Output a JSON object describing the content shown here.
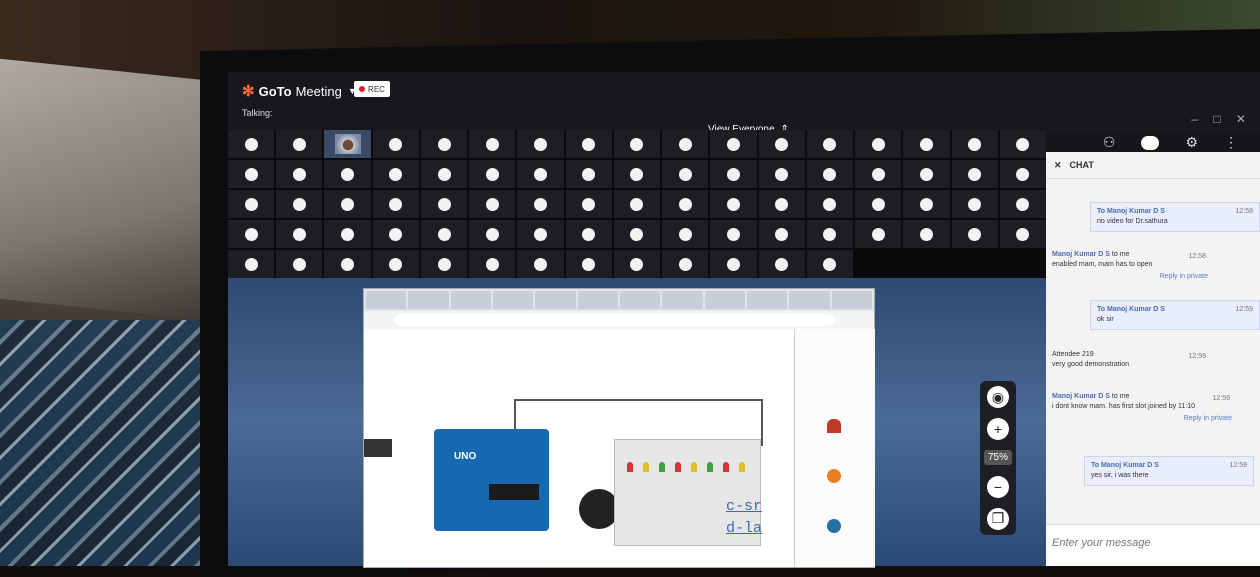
{
  "app": {
    "brand_goto": "GoTo",
    "brand_meeting": "Meeting",
    "rec_label": "REC",
    "talking_label": "Talking:"
  },
  "view": {
    "label": "View Everyone"
  },
  "chat": {
    "title": "CHAT",
    "messages": [
      {
        "dir": "out",
        "to": "To Manoj Kumar D S",
        "time": "12:58",
        "text": "no video for Dr.sathura"
      },
      {
        "dir": "in",
        "from": "Manoj Kumar D S",
        "meta": "to me",
        "time": "12:58",
        "text": "enabled mam, mam has to open",
        "reply": "Reply in private"
      },
      {
        "dir": "out",
        "to": "To Manoj Kumar D S",
        "time": "12:59",
        "text": "ok sir"
      },
      {
        "dir": "in",
        "from": "Attendee 219",
        "meta": "",
        "time": "12:59",
        "text": "very good demonstration"
      },
      {
        "dir": "in",
        "from": "Manoj Kumar D S",
        "meta": "to me",
        "time": "12:59",
        "text": "i dont know mam. has first slot joined by 11:10",
        "reply": "Reply in private"
      },
      {
        "dir": "out",
        "to": "To Manoj Kumar D S",
        "time": "12:59",
        "text": "yes sir, i was there"
      }
    ],
    "input_placeholder": "Enter your message"
  },
  "zoom": {
    "level": "75%"
  },
  "shared": {
    "code_line1": "c-sr",
    "code_line2": "d-la",
    "board_label": "UNO"
  }
}
